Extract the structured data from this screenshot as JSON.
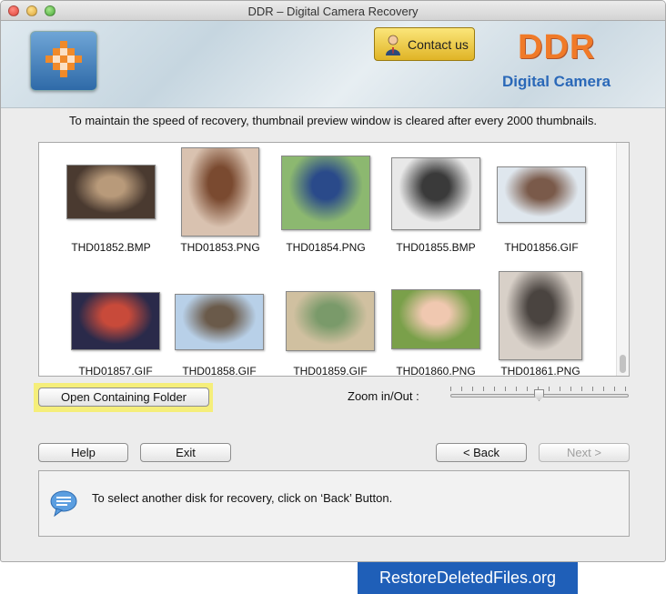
{
  "window": {
    "title": "DDR – Digital Camera Recovery"
  },
  "header": {
    "contact_label": "Contact us",
    "brand": "DDR",
    "brand_sub": "Digital Camera",
    "colors": {
      "brand": "#f07a28",
      "brand_sub": "#2a68b8"
    }
  },
  "notice": "To maintain the speed of recovery, thumbnail preview window is cleared after every 2000 thumbnails.",
  "thumbnails": [
    {
      "name": "THD01852.BMP",
      "icon": "photo-girl-dark"
    },
    {
      "name": "THD01853.PNG",
      "icon": "photo-girl-portrait"
    },
    {
      "name": "THD01854.PNG",
      "icon": "photo-reading-outdoors"
    },
    {
      "name": "THD01855.BMP",
      "icon": "photo-girl-grayscale"
    },
    {
      "name": "THD01856.GIF",
      "icon": "photo-couple-snow"
    },
    {
      "name": "THD01857.GIF",
      "icon": "photo-woman-scarf"
    },
    {
      "name": "THD01858.GIF",
      "icon": "photo-girl-sky"
    },
    {
      "name": "THD01859.GIF",
      "icon": "photo-family-sofa"
    },
    {
      "name": "THD01860.PNG",
      "icon": "photo-baby"
    },
    {
      "name": "THD01861.PNG",
      "icon": "photo-sketch-two-girls"
    }
  ],
  "controls": {
    "open_folder": "Open Containing Folder",
    "zoom_label": "Zoom in/Out :",
    "zoom_level": 0.5
  },
  "nav": {
    "help": "Help",
    "exit": "Exit",
    "back": "< Back",
    "next": "Next >"
  },
  "info": {
    "message": "To select another disk for recovery, click on ‘Back’ Button."
  },
  "footer": {
    "badge": "RestoreDeletedFiles.org"
  }
}
